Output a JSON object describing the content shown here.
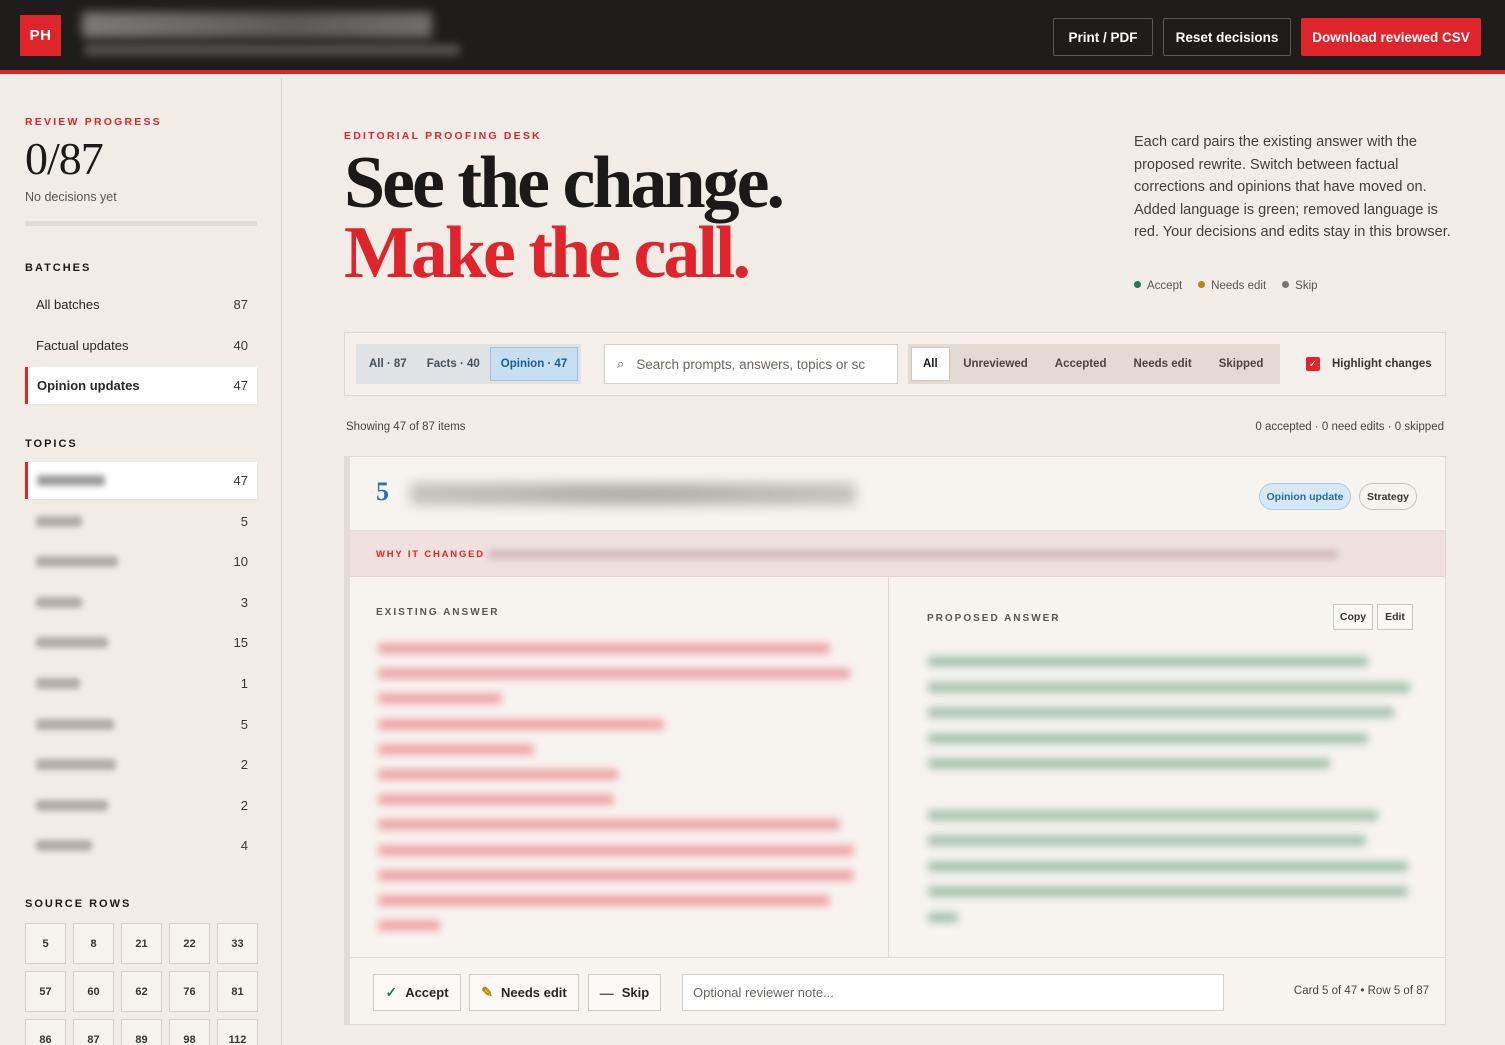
{
  "header": {
    "logo": "PH",
    "buttons": {
      "print": "Print / PDF",
      "reset": "Reset decisions",
      "download": "Download reviewed CSV"
    }
  },
  "sidebar": {
    "progress_label": "REVIEW PROGRESS",
    "progress_value": "0/87",
    "progress_fraction": 0,
    "progress_sub": "No decisions yet",
    "batches_title": "BATCHES",
    "batches": [
      {
        "label": "All batches",
        "count": "87",
        "active": false
      },
      {
        "label": "Factual updates",
        "count": "40",
        "active": false
      },
      {
        "label": "Opinion updates",
        "count": "47",
        "active": true
      }
    ],
    "topics_title": "TOPICS",
    "topic_counts": [
      "47",
      "5",
      "10",
      "3",
      "15",
      "1",
      "5",
      "2",
      "2",
      "4"
    ],
    "source_title": "SOURCE ROWS",
    "source_rows": [
      "5",
      "8",
      "21",
      "22",
      "33",
      "57",
      "60",
      "62",
      "76",
      "81",
      "86",
      "87",
      "89",
      "98",
      "112"
    ]
  },
  "hero": {
    "eyebrow": "EDITORIAL PROOFING DESK",
    "line1": "See the change.",
    "line2": "Make the call.",
    "description": "Each card pairs the existing answer with the proposed rewrite. Switch between factual corrections and opinions that have moved on. Added language is green; removed language is red. Your decisions and edits stay in this browser.",
    "legend": [
      {
        "label": "Accept",
        "color": "#1f7a4d"
      },
      {
        "label": "Needs edit",
        "color": "#b8860b"
      },
      {
        "label": "Skip",
        "color": "#7a746f"
      }
    ]
  },
  "toolbar": {
    "batch_tabs": [
      {
        "label": "All · 87",
        "active": false
      },
      {
        "label": "Facts · 40",
        "active": false
      },
      {
        "label": "Opinion · 47",
        "active": true
      }
    ],
    "search_placeholder": "Search prompts, answers, topics or sc",
    "status_tabs": [
      {
        "label": "All",
        "active": true
      },
      {
        "label": "Unreviewed",
        "active": false
      },
      {
        "label": "Accepted",
        "active": false
      },
      {
        "label": "Needs edit",
        "active": false
      },
      {
        "label": "Skipped",
        "active": false
      }
    ],
    "highlight_label": "Highlight changes",
    "highlight_checked": true
  },
  "list": {
    "showing": "Showing 47 of 87 items",
    "summary": "0 accepted · 0 need edits · 0 skipped"
  },
  "card": {
    "number": "5",
    "chips": {
      "type": "Opinion update",
      "topic": "Strategy"
    },
    "why_label": "WHY IT CHANGED",
    "existing_label": "EXISTING ANSWER",
    "proposed_label": "PROPOSED ANSWER",
    "copy_label": "Copy",
    "edit_label": "Edit",
    "actions": {
      "accept": "Accept",
      "needs_edit": "Needs edit",
      "skip": "Skip"
    },
    "note_placeholder": "Optional reviewer note...",
    "position": "Card 5 of 47  •  Row 5 of 87"
  },
  "colors": {
    "accent": "#e0242c",
    "link_blue": "#2b73b0"
  }
}
